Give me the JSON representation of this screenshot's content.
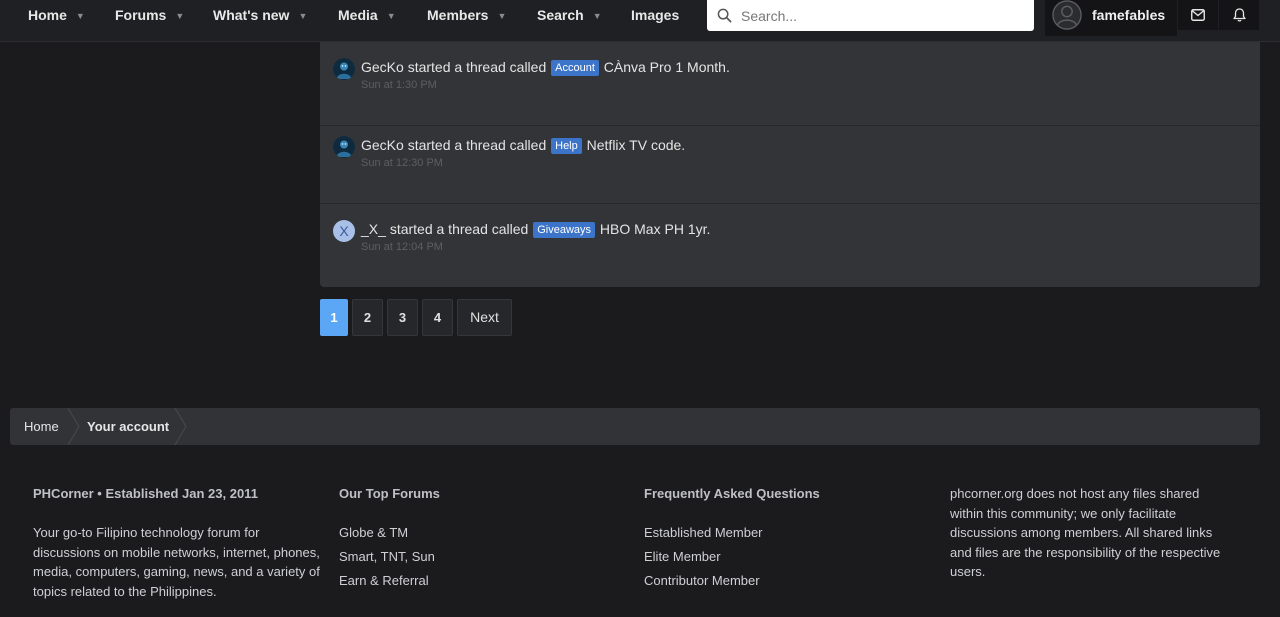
{
  "nav": {
    "items": [
      {
        "label": "Home"
      },
      {
        "label": "Forums"
      },
      {
        "label": "What's new"
      },
      {
        "label": "Media"
      },
      {
        "label": "Members"
      },
      {
        "label": "Search"
      },
      {
        "label": "Images"
      }
    ],
    "search_placeholder": "Search...",
    "username": "famefables"
  },
  "activity": [
    {
      "user": "GecKo",
      "action": "started a thread called",
      "prefix": "Account",
      "title": "CÀnva Pro 1 Month.",
      "time": "Sun at 1:30 PM",
      "avatar": "image"
    },
    {
      "user": "GecKo",
      "action": "started a thread called",
      "prefix": "Help",
      "title": "Netflix TV code.",
      "time": "Sun at 12:30 PM",
      "avatar": "image"
    },
    {
      "user": "_X_",
      "action": "started a thread called",
      "prefix": "Giveaways",
      "title": "HBO Max PH 1yr.",
      "time": "Sun at 12:04 PM",
      "avatar": "X"
    }
  ],
  "pagination": {
    "pages": [
      "1",
      "2",
      "3",
      "4"
    ],
    "current": "1",
    "next_label": "Next"
  },
  "breadcrumb": {
    "items": [
      "Home",
      "Your account"
    ]
  },
  "footer": {
    "about_title": "PHCorner • Established Jan 23, 2011",
    "about_text": "Your go-to Filipino technology forum for discussions on mobile networks, internet, phones, media, computers, gaming, news, and a variety of topics related to the Philippines.",
    "forums_title": "Our Top Forums",
    "forums": [
      "Globe & TM",
      "Smart, TNT, Sun",
      "Earn & Referral"
    ],
    "faq_title": "Frequently Asked Questions",
    "faq": [
      "Established Member",
      "Elite Member",
      "Contributor Member"
    ],
    "disclaimer": "phcorner.org does not host any files shared within this community; we only facilitate discussions among members. All shared links and files are the responsibility of the respective users."
  },
  "colors": {
    "accent": "#5ba7f5",
    "prefix": "#3b74c9",
    "background": "#1b1b1e",
    "panel": "#333437"
  }
}
